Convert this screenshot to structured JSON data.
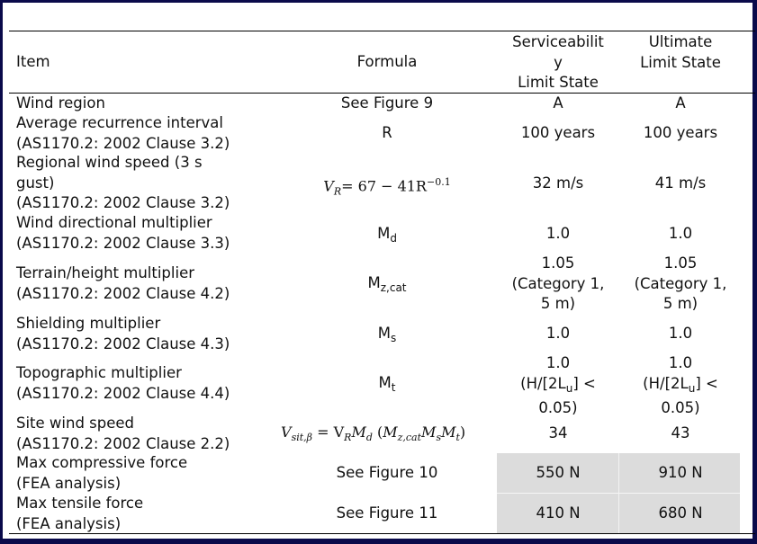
{
  "table": {
    "headers": {
      "item": "Item",
      "formula": "Formula",
      "sls": "Serviceabilit\ny\nLimit State",
      "uls": "Ultimate\nLimit State"
    },
    "rows": [
      {
        "item": "Wind region",
        "formula": "See Figure 9",
        "sls": "A",
        "uls": "A"
      },
      {
        "item": "Average recurrence interval\n(AS1170.2: 2002 Clause 3.2)",
        "formula": "R",
        "sls": "100 years",
        "uls": "100 years"
      },
      {
        "item": "Regional wind speed (3 s\ngust)\n(AS1170.2: 2002 Clause 3.2)",
        "formula_eq": {
          "lhs": "V",
          "lhs_sub": "R",
          "rhs": "= 67 − 41R",
          "rhs_sup": "−0.1"
        },
        "sls": "32 m/s",
        "uls": "41 m/s"
      },
      {
        "item": "Wind directional multiplier\n(AS1170.2: 2002 Clause 3.3)",
        "formula_sym": {
          "base": "M",
          "sub": "d"
        },
        "sls": "1.0",
        "uls": "1.0"
      },
      {
        "item": "Terrain/height multiplier\n(AS1170.2: 2002 Clause 4.2)",
        "formula_sym": {
          "base": "M",
          "sub": "z,cat"
        },
        "sls": "1.05\n(Category 1,\n5 m)",
        "uls": "1.05\n(Category 1,\n5 m)"
      },
      {
        "item": "Shielding multiplier\n(AS1170.2: 2002 Clause 4.3)",
        "formula_sym": {
          "base": "M",
          "sub": "s"
        },
        "sls": "1.0",
        "uls": "1.0"
      },
      {
        "item": "Topographic multiplier\n(AS1170.2: 2002 Clause 4.4)",
        "formula_sym": {
          "base": "M",
          "sub": "t"
        },
        "sls_parts": {
          "l1": "1.0",
          "l2a": "(H/[2L",
          "l2sub": "u",
          "l2b": "] <",
          "l3": "0.05)"
        },
        "uls_parts": {
          "l1": "1.0",
          "l2a": "(H/[2L",
          "l2sub": "u",
          "l2b": "] <",
          "l3": "0.05)"
        }
      },
      {
        "item": "Site wind speed\n(AS1170.2: 2002 Clause 2.2)",
        "formula_eq": {
          "v": "V",
          "v_sub": "sit,β",
          "eq": " = V",
          "vr_sub": "R",
          "m": "M",
          "md_sub": "d",
          "open": " (",
          "mz": "M",
          "mz_sub": "z,cat",
          "ms": "M",
          "ms_sub": "s",
          "mt": "M",
          "mt_sub": "t",
          "close": ")"
        },
        "sls": "34",
        "uls": "43"
      },
      {
        "item": "Max compressive force\n(FEA analysis)",
        "formula": "See Figure 10",
        "sls": "550 N",
        "uls": "910 N"
      },
      {
        "item": "Max tensile force\n(FEA analysis)",
        "formula": "See Figure 11",
        "sls": "410 N",
        "uls": "680 N"
      }
    ]
  },
  "colors": {
    "frame": "#0a0a4a",
    "highlight_cell": "#dcdcdc"
  }
}
